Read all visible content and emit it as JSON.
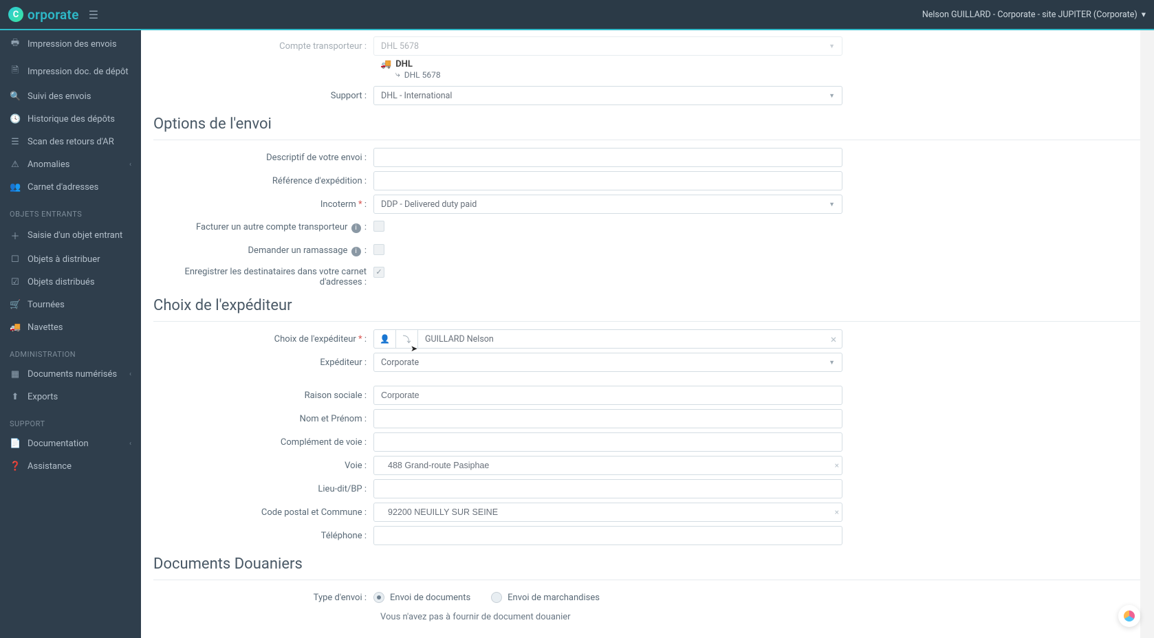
{
  "app": {
    "logo_glyph": "C",
    "logo_text": "orporate",
    "user_display": "Nelson GUILLARD - Corporate - site JUPITER (Corporate)"
  },
  "sidebar": {
    "items_top": [
      {
        "label": "Impression des envois",
        "icon": "i-print"
      },
      {
        "label": "Impression doc. de dépôt",
        "icon": "i-doc"
      },
      {
        "label": "Suivi des envois",
        "icon": "i-search"
      },
      {
        "label": "Historique des dépôts",
        "icon": "i-history"
      },
      {
        "label": "Scan des retours d'AR",
        "icon": "i-scan"
      },
      {
        "label": "Anomalies",
        "icon": "i-warning",
        "expandable": true
      },
      {
        "label": "Carnet d'adresses",
        "icon": "i-book"
      }
    ],
    "section_incoming": "OBJETS ENTRANTS",
    "items_incoming": [
      {
        "label": "Saisie d'un objet entrant",
        "icon": "i-plus"
      },
      {
        "label": "Objets à distribuer",
        "icon": "i-box"
      },
      {
        "label": "Objets distribués",
        "icon": "i-check"
      },
      {
        "label": "Tournées",
        "icon": "i-cart"
      },
      {
        "label": "Navettes",
        "icon": "i-truck"
      }
    ],
    "section_admin": "ADMINISTRATION",
    "items_admin": [
      {
        "label": "Documents numérisés",
        "icon": "i-grid",
        "expandable": true
      },
      {
        "label": "Exports",
        "icon": "i-upload"
      }
    ],
    "section_support": "SUPPORT",
    "items_support": [
      {
        "label": "Documentation",
        "icon": "i-docu",
        "expandable": true
      },
      {
        "label": "Assistance",
        "icon": "i-help"
      }
    ]
  },
  "form": {
    "compte_transporteur": {
      "label": "Compte transporteur :",
      "value": "DHL 5678"
    },
    "carrier": {
      "name": "DHL",
      "account": "DHL 5678"
    },
    "support": {
      "label": "Support :",
      "value": "DHL - International"
    },
    "section_options": "Options de l'envoi",
    "descriptif": {
      "label": "Descriptif de votre envoi :",
      "value": ""
    },
    "reference": {
      "label": "Référence d'expédition :",
      "value": ""
    },
    "incoterm": {
      "label": "Incoterm ",
      "value": "DDP - Delivered duty paid"
    },
    "facturer_autre": {
      "label": "Facturer un autre compte transporteur "
    },
    "demander_ramassage": {
      "label": "Demander un ramassage "
    },
    "enregistrer_dest": {
      "label": "Enregistrer les destinataires dans votre carnet d'adresses :"
    },
    "section_expediteur": "Choix de l'expéditeur",
    "choix_expediteur": {
      "label": "Choix de l'expéditeur ",
      "value": "GUILLARD Nelson"
    },
    "expediteur": {
      "label": "Expéditeur :",
      "value": "Corporate"
    },
    "raison_sociale": {
      "label": "Raison sociale :",
      "value": "Corporate"
    },
    "nom_prenom": {
      "label": "Nom et Prénom :",
      "value": ""
    },
    "complement_voie": {
      "label": "Complément de voie :",
      "value": ""
    },
    "voie": {
      "label": "Voie :",
      "value": "488 Grand-route Pasiphae"
    },
    "lieu_dit": {
      "label": "Lieu-dit/BP :",
      "value": ""
    },
    "code_postal": {
      "label": "Code postal et Commune :",
      "value": "92200 NEUILLY SUR SEINE"
    },
    "telephone": {
      "label": "Téléphone :",
      "value": ""
    },
    "section_douane": "Documents Douaniers",
    "type_envoi": {
      "label": "Type d'envoi :",
      "opt1": "Envoi de documents",
      "opt2": "Envoi de marchandises"
    },
    "douane_hint": "Vous n'avez pas à fournir de document douanier"
  },
  "required_marker": "*"
}
